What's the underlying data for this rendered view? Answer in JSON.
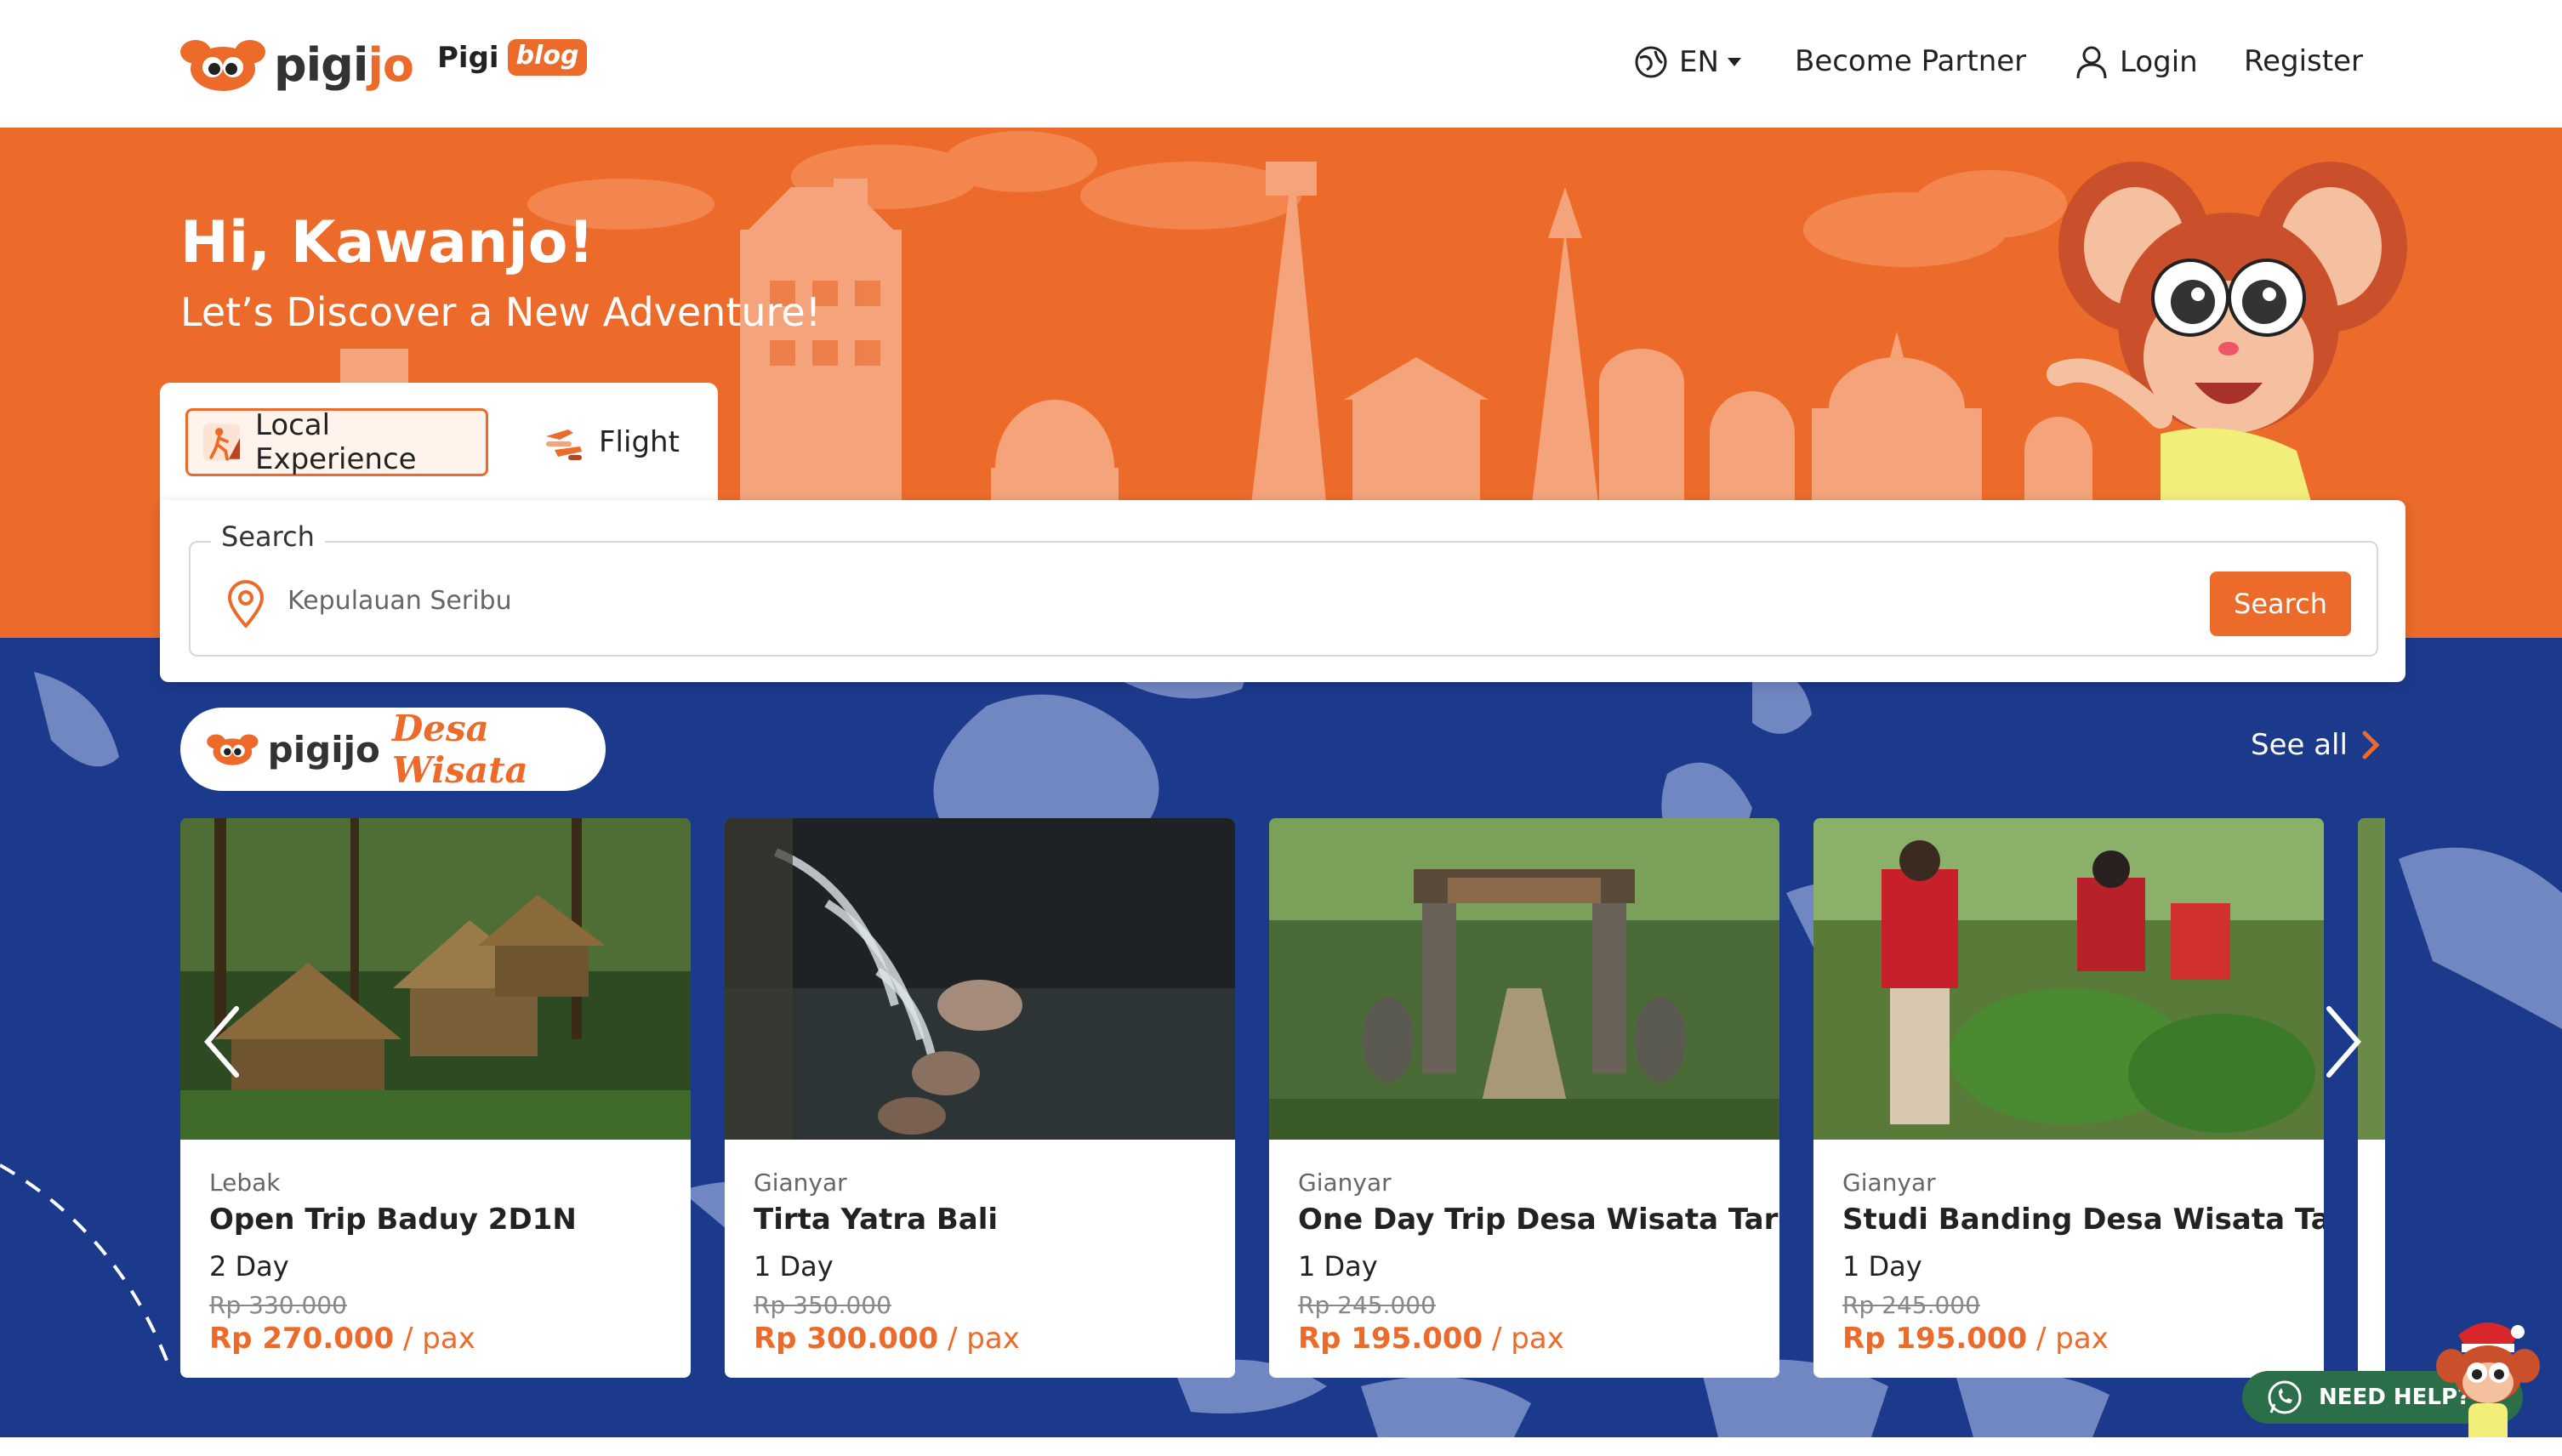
{
  "brand": {
    "logo_text_a": "pigi",
    "logo_text_b": "jo",
    "blog_prefix": "Pigi",
    "blog_badge": "blog",
    "accent": "#ec6b2b",
    "map_blue": "#1c3a8c"
  },
  "nav": {
    "language": "EN",
    "become_partner": "Become Partner",
    "login": "Login",
    "register": "Register"
  },
  "hero": {
    "title": "Hi, Kawanjo!",
    "subtitle": "Let’s Discover a New Adventure!"
  },
  "search": {
    "tabs": [
      {
        "label": "Local Experience",
        "active": true,
        "icon": "hiker-icon"
      },
      {
        "label": "Flight",
        "active": false,
        "icon": "plane-icon"
      }
    ],
    "legend": "Search",
    "placeholder": "Kepulauan Seribu",
    "button": "Search"
  },
  "desa": {
    "badge_text": "pigijo",
    "badge_script": "Desa Wisata",
    "see_all": "See all"
  },
  "cards": [
    {
      "location": "Lebak",
      "title": "Open Trip Baduy 2D1N",
      "duration": "2 Day",
      "old_price": "Rp 330.000",
      "price": "Rp 270.000",
      "unit": " / pax"
    },
    {
      "location": "Gianyar",
      "title": "Tirta Yatra Bali",
      "duration": "1 Day",
      "old_price": "Rp 350.000",
      "price": "Rp 300.000",
      "unit": " / pax"
    },
    {
      "location": "Gianyar",
      "title": "One Day Trip Desa Wisata Taro",
      "duration": "1 Day",
      "old_price": "Rp 245.000",
      "price": "Rp 195.000",
      "unit": " / pax"
    },
    {
      "location": "Gianyar",
      "title": "Studi Banding Desa Wisata Taro",
      "duration": "1 Day",
      "old_price": "Rp 245.000",
      "price": "Rp 195.000",
      "unit": " / pax"
    }
  ],
  "help": {
    "label": "NEED HELP?"
  }
}
